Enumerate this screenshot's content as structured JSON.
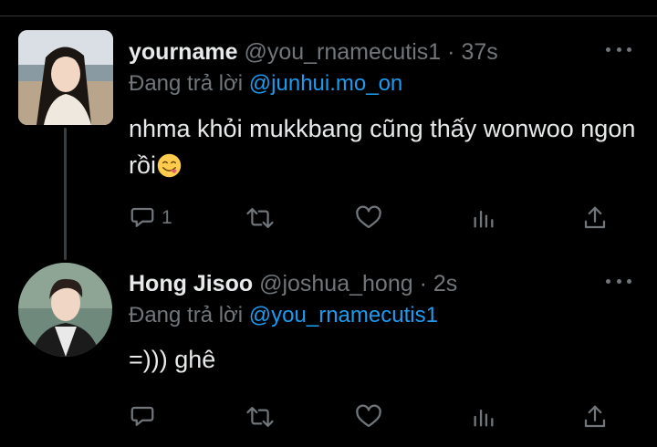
{
  "colors": {
    "background": "#000000",
    "text": "#e7e9ea",
    "muted": "#71767b",
    "mention": "#1d9bf0"
  },
  "tweets": [
    {
      "display_name": "yourname",
      "handle": "@you_rnamecutis1",
      "separator": "·",
      "time": "37s",
      "reply_label": "Đang trả lời",
      "reply_to": "@junhui.mo_on",
      "text": "nhma khỏi mukkbang cũng thấy wonwoo ngon rồi",
      "emoji": "face-savoring-food-emoji",
      "reply_count": "1",
      "icons": [
        "reply-icon",
        "retweet-icon",
        "like-icon",
        "views-icon",
        "share-icon",
        "more-icon"
      ]
    },
    {
      "display_name": "Hong Jisoo",
      "handle": "@joshua_hong",
      "separator": "·",
      "time": "2s",
      "reply_label": "Đang trả lời",
      "reply_to": "@you_rnamecutis1",
      "text": "=))) ghê",
      "reply_count": "",
      "icons": [
        "reply-icon",
        "retweet-icon",
        "like-icon",
        "views-icon",
        "share-icon",
        "more-icon"
      ]
    }
  ]
}
